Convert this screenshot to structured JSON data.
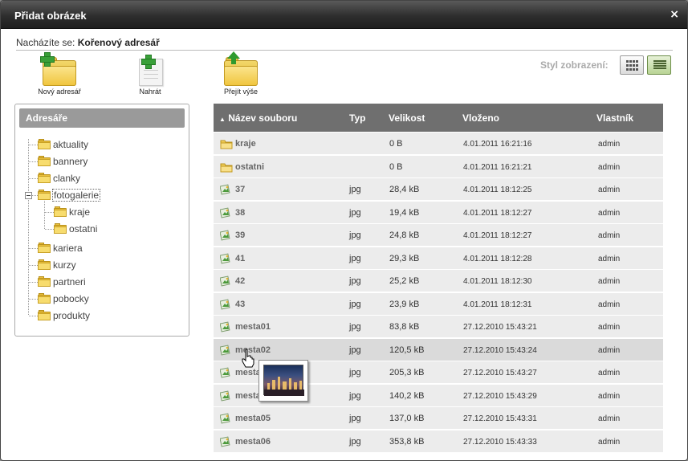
{
  "dialog": {
    "title": "Přidat obrázek",
    "close_label": "×"
  },
  "location": {
    "label": "Nacházíte se:",
    "value": "Kořenový adresář"
  },
  "toolbar": {
    "new_folder_label": "Nový adresář",
    "upload_label": "Nahrát",
    "go_up_label": "Přejít výše"
  },
  "view_style": {
    "label": "Styl zobrazení:",
    "active": "list"
  },
  "tree": {
    "header": "Adresáře",
    "items": [
      {
        "label": "aktuality"
      },
      {
        "label": "bannery"
      },
      {
        "label": "clanky"
      },
      {
        "label": "fotogalerie"
      },
      {
        "label": "kraje"
      },
      {
        "label": "ostatni"
      },
      {
        "label": "kariera"
      },
      {
        "label": "kurzy"
      },
      {
        "label": "partneri"
      },
      {
        "label": "pobocky"
      },
      {
        "label": "produkty"
      }
    ],
    "selected": "fotogalerie"
  },
  "files": {
    "columns": {
      "name": "Název souboru",
      "type": "Typ",
      "size": "Velikost",
      "date": "Vloženo",
      "owner": "Vlastník"
    },
    "sort_indicator": "▲",
    "rows": [
      {
        "kind": "folder",
        "name": "kraje",
        "type": "",
        "size": "0 B",
        "date": "4.01.2011 16:21:16",
        "owner": "admin"
      },
      {
        "kind": "folder",
        "name": "ostatni",
        "type": "",
        "size": "0 B",
        "date": "4.01.2011 16:21:21",
        "owner": "admin"
      },
      {
        "kind": "image",
        "name": "37",
        "type": "jpg",
        "size": "28,4 kB",
        "date": "4.01.2011 18:12:25",
        "owner": "admin"
      },
      {
        "kind": "image",
        "name": "38",
        "type": "jpg",
        "size": "19,4 kB",
        "date": "4.01.2011 18:12:27",
        "owner": "admin"
      },
      {
        "kind": "image",
        "name": "39",
        "type": "jpg",
        "size": "24,8 kB",
        "date": "4.01.2011 18:12:27",
        "owner": "admin"
      },
      {
        "kind": "image",
        "name": "41",
        "type": "jpg",
        "size": "29,3 kB",
        "date": "4.01.2011 18:12:28",
        "owner": "admin"
      },
      {
        "kind": "image",
        "name": "42",
        "type": "jpg",
        "size": "25,2 kB",
        "date": "4.01.2011 18:12:30",
        "owner": "admin"
      },
      {
        "kind": "image",
        "name": "43",
        "type": "jpg",
        "size": "23,9 kB",
        "date": "4.01.2011 18:12:31",
        "owner": "admin"
      },
      {
        "kind": "image",
        "name": "mesta01",
        "type": "jpg",
        "size": "83,8 kB",
        "date": "27.12.2010 15:43:21",
        "owner": "admin"
      },
      {
        "kind": "image",
        "name": "mesta02",
        "type": "jpg",
        "size": "120,5 kB",
        "date": "27.12.2010 15:43:24",
        "owner": "admin"
      },
      {
        "kind": "image",
        "name": "mesta03",
        "type": "jpg",
        "size": "205,3 kB",
        "date": "27.12.2010 15:43:27",
        "owner": "admin"
      },
      {
        "kind": "image",
        "name": "mesta04",
        "type": "jpg",
        "size": "140,2 kB",
        "date": "27.12.2010 15:43:29",
        "owner": "admin"
      },
      {
        "kind": "image",
        "name": "mesta05",
        "type": "jpg",
        "size": "137,0 kB",
        "date": "27.12.2010 15:43:31",
        "owner": "admin"
      },
      {
        "kind": "image",
        "name": "mesta06",
        "type": "jpg",
        "size": "353,8 kB",
        "date": "27.12.2010 15:43:33",
        "owner": "admin"
      }
    ],
    "hovered": "mesta02"
  },
  "colors": {
    "accent": "#6f6f6f",
    "row_bg": "#ececec",
    "row_hover": "#dadada",
    "active_view": "#b9d494"
  },
  "icons": {
    "folder": "folder-icon",
    "image": "image-file-icon",
    "new_folder": "folder-plus-icon",
    "upload": "document-plus-icon",
    "go_up": "folder-up-icon",
    "grid_view": "grid-view-icon",
    "list_view": "list-view-icon"
  }
}
